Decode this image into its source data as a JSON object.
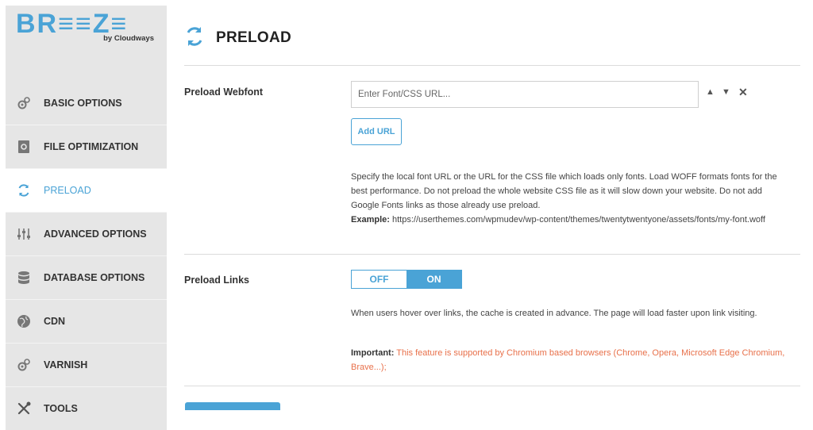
{
  "logo": {
    "word": "BR≡≡Z≡",
    "sub": "by Cloudways"
  },
  "sidebar": {
    "items": [
      {
        "label": "BASIC OPTIONS",
        "icon": "gears-icon",
        "active": false
      },
      {
        "label": "FILE OPTIMIZATION",
        "icon": "file-gear-icon",
        "active": false
      },
      {
        "label": "PRELOAD",
        "icon": "sync-arrows-icon",
        "active": true
      },
      {
        "label": "ADVANCED OPTIONS",
        "icon": "sliders-icon",
        "active": false
      },
      {
        "label": "DATABASE OPTIONS",
        "icon": "database-icon",
        "active": false
      },
      {
        "label": "CDN",
        "icon": "globe-icon",
        "active": false
      },
      {
        "label": "VARNISH",
        "icon": "gears-icon",
        "active": false
      },
      {
        "label": "TOOLS",
        "icon": "tools-icon",
        "active": false
      }
    ]
  },
  "header": {
    "title": "PRELOAD",
    "icon": "sync-arrows-icon"
  },
  "preload_webfont": {
    "label": "Preload Webfont",
    "placeholder": "Enter Font/CSS URL...",
    "add_button": "Add URL",
    "description": "Specify the local font URL or the URL for the CSS file which loads only fonts. Load WOFF formats fonts for the best performance. Do not preload the whole website CSS file as it will slow down your website. Do not add Google Fonts links as those already use preload.",
    "example_label": "Example:",
    "example_value": "https://userthemes.com/wpmudev/wp-content/themes/twentytwentyone/assets/fonts/my-font.woff"
  },
  "preload_links": {
    "label": "Preload Links",
    "toggle_off": "OFF",
    "toggle_on": "ON",
    "description": "When users hover over links, the cache is created in advance. The page will load faster upon link visiting.",
    "important_label": "Important:",
    "important_text": "This feature is supported by Chromium based browsers (Chrome, Opera, Microsoft Edge Chromium, Brave...);"
  },
  "colors": {
    "accent": "#4aa3d6",
    "sidebar_bg": "#e6e6e6",
    "important": "#e8704a"
  }
}
